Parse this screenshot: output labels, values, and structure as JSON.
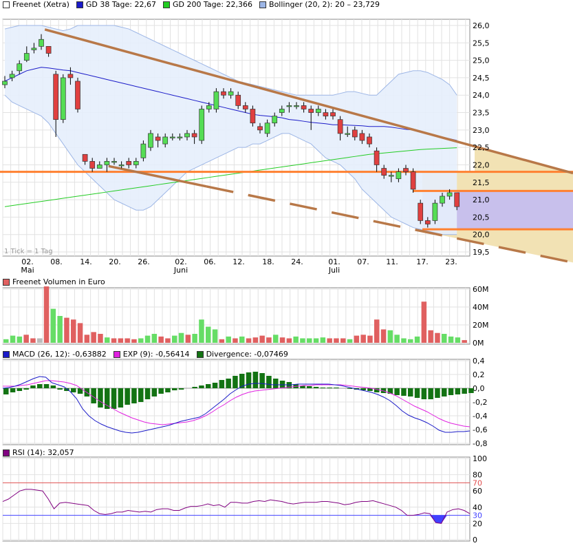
{
  "legends": {
    "price": [
      {
        "label": "Freenet (Xetra)",
        "color": "#ffffff"
      },
      {
        "label": "GD 38 Tage: 22,67",
        "color": "#1a1ac8"
      },
      {
        "label": "GD 200 Tage: 22,366",
        "color": "#22cc22"
      },
      {
        "label": "Bollinger (20, 2): 20 – 23,729",
        "color": "#9db6e6"
      }
    ],
    "volume": [
      {
        "label": "Freenet Volumen in Euro",
        "color": "#e06060"
      }
    ],
    "macd": [
      {
        "label": "MACD (26, 12): -0,63882",
        "color": "#1a1ac8"
      },
      {
        "label": "EXP (9): -0,56414",
        "color": "#e020e0"
      },
      {
        "label": "Divergence: -0,07469",
        "color": "#137313"
      }
    ],
    "rsi": [
      {
        "label": "RSI (14): 32,057",
        "color": "#800080"
      }
    ]
  },
  "tick_note": "1 Tick = 1 Tag",
  "colors": {
    "up": "#55dd55",
    "down": "#e04040",
    "trend": "#b87848",
    "level": "#ff8030",
    "fill_tan": "#f2e2b4",
    "fill_purple": "#c8c0ec",
    "bollinger_fill": "#e6eefc",
    "ma38": "#1a1ac8",
    "ma200": "#22cc22",
    "vol_up": "#66dd66",
    "vol_down": "#e06060",
    "macd_line": "#1a1ac8",
    "exp_line": "#e020e0",
    "divergence": "#137313",
    "rsi_line": "#800080"
  },
  "chart_data": [
    {
      "type": "candlestick",
      "title": "Freenet (Xetra)",
      "ylim": [
        19.5,
        26.0
      ],
      "y_ticks": [
        "26,0",
        "25,5",
        "25,0",
        "24,5",
        "24,0",
        "23,5",
        "23,0",
        "22,5",
        "22,0",
        "21,5",
        "21,0",
        "20,5",
        "20,0",
        "19,5"
      ],
      "x_tick_labels": [
        "02.",
        "08.",
        "14.",
        "20.",
        "26.",
        "02.",
        "06.",
        "12.",
        "18.",
        "24.",
        "01.",
        "07.",
        "11.",
        "17.",
        "23."
      ],
      "month_labels": [
        "Mai",
        "Juni",
        "Juli"
      ],
      "candles": [
        {
          "o": 24.3,
          "c": 24.4,
          "h": 24.55,
          "l": 24.2
        },
        {
          "o": 24.5,
          "c": 24.6,
          "h": 24.7,
          "l": 24.4
        },
        {
          "o": 24.7,
          "c": 24.9,
          "h": 25.0,
          "l": 24.6
        },
        {
          "o": 25.0,
          "c": 25.2,
          "h": 25.4,
          "l": 24.95
        },
        {
          "o": 25.3,
          "c": 25.35,
          "h": 25.5,
          "l": 25.2
        },
        {
          "o": 25.4,
          "c": 25.6,
          "h": 25.75,
          "l": 25.3
        },
        {
          "o": 25.4,
          "c": 25.2,
          "h": 25.4,
          "l": 25.1
        },
        {
          "o": 24.6,
          "c": 23.3,
          "h": 24.7,
          "l": 22.8
        },
        {
          "o": 23.3,
          "c": 24.5,
          "h": 24.6,
          "l": 23.2
        },
        {
          "o": 24.6,
          "c": 24.5,
          "h": 24.8,
          "l": 24.3
        },
        {
          "o": 24.4,
          "c": 23.6,
          "h": 24.5,
          "l": 23.5
        },
        {
          "o": 22.3,
          "c": 22.1,
          "h": 22.3,
          "l": 22.0
        },
        {
          "o": 22.1,
          "c": 21.9,
          "h": 22.2,
          "l": 21.8
        },
        {
          "o": 21.9,
          "c": 22.0,
          "h": 22.1,
          "l": 21.9
        },
        {
          "o": 22.0,
          "c": 22.1,
          "h": 22.2,
          "l": 21.8
        },
        {
          "o": 22.1,
          "c": 22.1,
          "h": 22.2,
          "l": 22.0
        },
        {
          "o": 22.0,
          "c": 22.0,
          "h": 22.1,
          "l": 21.9
        },
        {
          "o": 22.1,
          "c": 22.0,
          "h": 22.2,
          "l": 21.9
        },
        {
          "o": 22.0,
          "c": 22.1,
          "h": 22.2,
          "l": 21.9
        },
        {
          "o": 22.2,
          "c": 22.6,
          "h": 22.7,
          "l": 22.1
        },
        {
          "o": 22.5,
          "c": 22.9,
          "h": 23.0,
          "l": 22.4
        },
        {
          "o": 22.8,
          "c": 22.7,
          "h": 22.9,
          "l": 22.5
        },
        {
          "o": 22.6,
          "c": 22.8,
          "h": 22.9,
          "l": 22.5
        },
        {
          "o": 22.8,
          "c": 22.8,
          "h": 22.9,
          "l": 22.7
        },
        {
          "o": 22.8,
          "c": 22.8,
          "h": 22.9,
          "l": 22.7
        },
        {
          "o": 22.8,
          "c": 22.9,
          "h": 23.0,
          "l": 22.7
        },
        {
          "o": 22.9,
          "c": 22.8,
          "h": 23.0,
          "l": 22.6
        },
        {
          "o": 22.7,
          "c": 23.6,
          "h": 23.7,
          "l": 22.6
        },
        {
          "o": 23.6,
          "c": 23.7,
          "h": 23.8,
          "l": 23.5
        },
        {
          "o": 23.6,
          "c": 24.1,
          "h": 24.2,
          "l": 23.5
        },
        {
          "o": 24.1,
          "c": 24.0,
          "h": 24.2,
          "l": 23.9
        },
        {
          "o": 24.0,
          "c": 24.1,
          "h": 24.2,
          "l": 23.9
        },
        {
          "o": 24.0,
          "c": 23.7,
          "h": 24.1,
          "l": 23.6
        },
        {
          "o": 23.7,
          "c": 23.6,
          "h": 23.8,
          "l": 23.5
        },
        {
          "o": 23.6,
          "c": 23.2,
          "h": 23.7,
          "l": 23.1
        },
        {
          "o": 23.1,
          "c": 23.0,
          "h": 23.2,
          "l": 22.9
        },
        {
          "o": 22.9,
          "c": 23.2,
          "h": 23.3,
          "l": 22.8
        },
        {
          "o": 23.2,
          "c": 23.4,
          "h": 23.5,
          "l": 23.1
        },
        {
          "o": 23.5,
          "c": 23.6,
          "h": 23.7,
          "l": 23.4
        },
        {
          "o": 23.7,
          "c": 23.7,
          "h": 23.8,
          "l": 23.5
        },
        {
          "o": 23.7,
          "c": 23.7,
          "h": 23.8,
          "l": 23.6
        },
        {
          "o": 23.7,
          "c": 23.6,
          "h": 23.8,
          "l": 23.5
        },
        {
          "o": 23.6,
          "c": 23.5,
          "h": 23.7,
          "l": 23.0
        },
        {
          "o": 23.5,
          "c": 23.6,
          "h": 23.7,
          "l": 23.4
        },
        {
          "o": 23.5,
          "c": 23.4,
          "h": 23.6,
          "l": 23.3
        },
        {
          "o": 23.5,
          "c": 23.4,
          "h": 23.6,
          "l": 23.3
        },
        {
          "o": 23.3,
          "c": 22.9,
          "h": 23.4,
          "l": 22.7
        },
        {
          "o": 22.9,
          "c": 22.9,
          "h": 23.1,
          "l": 22.8
        },
        {
          "o": 23.0,
          "c": 22.8,
          "h": 23.1,
          "l": 22.7
        },
        {
          "o": 22.9,
          "c": 22.7,
          "h": 23.0,
          "l": 22.6
        },
        {
          "o": 22.8,
          "c": 22.6,
          "h": 22.9,
          "l": 22.5
        },
        {
          "o": 22.4,
          "c": 22.0,
          "h": 22.5,
          "l": 21.8
        },
        {
          "o": 21.9,
          "c": 21.7,
          "h": 22.0,
          "l": 21.6
        },
        {
          "o": 21.7,
          "c": 21.7,
          "h": 21.8,
          "l": 21.5
        },
        {
          "o": 21.6,
          "c": 21.8,
          "h": 21.9,
          "l": 21.5
        },
        {
          "o": 21.9,
          "c": 21.8,
          "h": 22.0,
          "l": 21.7
        },
        {
          "o": 21.8,
          "c": 21.3,
          "h": 21.9,
          "l": 21.2
        },
        {
          "o": 20.9,
          "c": 20.4,
          "h": 21.0,
          "l": 20.3
        },
        {
          "o": 20.4,
          "c": 20.3,
          "h": 20.5,
          "l": 20.2
        },
        {
          "o": 20.4,
          "c": 20.9,
          "h": 21.0,
          "l": 20.3
        },
        {
          "o": 20.9,
          "c": 21.1,
          "h": 21.2,
          "l": 20.8
        },
        {
          "o": 21.1,
          "c": 21.2,
          "h": 21.3,
          "l": 21.0
        },
        {
          "o": 21.2,
          "c": 20.8,
          "h": 21.2,
          "l": 20.7
        }
      ],
      "ma38": [
        24.4,
        24.5,
        24.6,
        24.7,
        24.75,
        24.8,
        24.78,
        24.75,
        24.72,
        24.7,
        24.65,
        24.6,
        24.55,
        24.5,
        24.45,
        24.4,
        24.35,
        24.3,
        24.25,
        24.2,
        24.15,
        24.1,
        24.05,
        24.0,
        23.95,
        23.9,
        23.85,
        23.8,
        23.75,
        23.7,
        23.65,
        23.6,
        23.55,
        23.5,
        23.45,
        23.42,
        23.4,
        23.38,
        23.35,
        23.3,
        23.28,
        23.25,
        23.22,
        23.2,
        23.18,
        23.15,
        23.15,
        23.14,
        23.13,
        23.12,
        23.1,
        23.1,
        23.1,
        23.08,
        23.05,
        23.02,
        23.0,
        22.95,
        22.9,
        22.85,
        22.8,
        22.75,
        22.7
      ],
      "ma200": [
        20.8,
        20.83,
        20.86,
        20.89,
        20.92,
        20.95,
        20.98,
        21.01,
        21.04,
        21.07,
        21.1,
        21.13,
        21.16,
        21.19,
        21.22,
        21.25,
        21.28,
        21.31,
        21.34,
        21.37,
        21.4,
        21.43,
        21.46,
        21.49,
        21.52,
        21.55,
        21.58,
        21.61,
        21.64,
        21.67,
        21.7,
        21.73,
        21.76,
        21.79,
        21.82,
        21.85,
        21.88,
        21.91,
        21.94,
        21.97,
        22.0,
        22.03,
        22.06,
        22.09,
        22.12,
        22.15,
        22.18,
        22.21,
        22.24,
        22.27,
        22.3,
        22.32,
        22.34,
        22.36,
        22.38,
        22.4,
        22.42,
        22.44,
        22.45,
        22.46,
        22.47,
        22.48,
        22.49
      ],
      "boll_upper": [
        25.9,
        25.95,
        26.0,
        26.0,
        26.0,
        26.0,
        25.95,
        25.9,
        25.85,
        25.9,
        26.0,
        26.0,
        26.0,
        26.0,
        26.0,
        26.0,
        25.95,
        25.9,
        25.8,
        25.7,
        25.6,
        25.5,
        25.4,
        25.3,
        25.2,
        25.1,
        25.0,
        24.9,
        24.8,
        24.7,
        24.6,
        24.5,
        24.4,
        24.35,
        24.3,
        24.25,
        24.2,
        24.15,
        24.1,
        24.05,
        24.0,
        24.0,
        24.0,
        24.0,
        24.0,
        24.0,
        24.05,
        24.1,
        24.1,
        24.05,
        24.0,
        24.0,
        24.2,
        24.4,
        24.6,
        24.65,
        24.7,
        24.7,
        24.65,
        24.55,
        24.45,
        24.3,
        24.0
      ],
      "boll_lower": [
        24.0,
        23.8,
        23.7,
        23.6,
        23.5,
        23.4,
        23.2,
        22.9,
        22.6,
        22.3,
        22.0,
        21.8,
        21.6,
        21.4,
        21.2,
        21.0,
        20.9,
        20.8,
        20.7,
        20.7,
        20.8,
        21.0,
        21.2,
        21.4,
        21.6,
        21.8,
        21.9,
        22.0,
        22.1,
        22.2,
        22.3,
        22.4,
        22.5,
        22.5,
        22.6,
        22.6,
        22.7,
        22.8,
        22.9,
        22.9,
        22.8,
        22.7,
        22.6,
        22.4,
        22.2,
        22.1,
        22.0,
        21.8,
        21.6,
        21.3,
        21.1,
        20.9,
        20.7,
        20.5,
        20.4,
        20.3,
        20.2,
        20.15,
        20.1,
        20.05,
        20.0,
        20.0,
        20.0
      ],
      "levels": [
        21.8,
        21.25,
        20.15
      ],
      "trend_upper": {
        "start": {
          "i": 7,
          "y": 25.8
        },
        "end": {
          "i": 79,
          "y": 21.7
        }
      },
      "trend_lower": {
        "start": {
          "i": 18,
          "y": 21.8
        },
        "end": {
          "i": 79,
          "y": 19.15
        }
      }
    },
    {
      "type": "bar",
      "title": "Freenet Volumen in Euro",
      "ylim": [
        0,
        60
      ],
      "y_ticks": [
        "60M",
        "40M",
        "20M",
        "0M"
      ],
      "values": [
        4,
        8,
        7,
        9,
        5,
        5,
        63,
        38,
        30,
        28,
        26,
        22,
        9,
        12,
        10,
        6,
        5,
        5,
        5,
        4,
        5,
        8,
        10,
        7,
        5,
        8,
        11,
        9,
        10,
        26,
        18,
        15,
        4,
        7,
        5,
        7,
        5,
        6,
        8,
        6,
        9,
        6,
        5,
        7,
        5,
        5,
        5,
        6,
        5,
        5,
        5,
        4,
        8,
        9,
        8,
        26,
        15,
        14,
        9,
        5,
        4,
        7,
        46,
        14,
        11,
        10,
        7,
        6,
        3
      ],
      "up": [
        1,
        1,
        1,
        0,
        0,
        0,
        0,
        1,
        1,
        0,
        0,
        0,
        0,
        0,
        0,
        1,
        0,
        0,
        0,
        0,
        1,
        1,
        1,
        0,
        0,
        1,
        1,
        0,
        1,
        1,
        1,
        1,
        0,
        1,
        0,
        1,
        0,
        0,
        0,
        0,
        1,
        0,
        0,
        1,
        1,
        1,
        1,
        1,
        0,
        0,
        0,
        1,
        0,
        0,
        0,
        0,
        0,
        1,
        1,
        1,
        1,
        1,
        0,
        0,
        0,
        1,
        1,
        1,
        0
      ]
    },
    {
      "type": "line+bar",
      "title": "MACD (26, 12)",
      "ylim": [
        -0.8,
        0.4
      ],
      "y_ticks": [
        "0,4",
        "0,2",
        "0,0",
        "-0,2",
        "-0,4",
        "-0,6",
        "-0,8"
      ],
      "macd": [
        0.0,
        0.01,
        0.03,
        0.06,
        0.1,
        0.14,
        0.17,
        0.16,
        0.08,
        0.05,
        0.02,
        -0.05,
        -0.15,
        -0.3,
        -0.4,
        -0.47,
        -0.52,
        -0.56,
        -0.59,
        -0.62,
        -0.64,
        -0.65,
        -0.64,
        -0.62,
        -0.6,
        -0.58,
        -0.56,
        -0.54,
        -0.51,
        -0.48,
        -0.46,
        -0.44,
        -0.42,
        -0.37,
        -0.3,
        -0.23,
        -0.16,
        -0.08,
        -0.02,
        0.03,
        0.06,
        0.07,
        0.07,
        0.06,
        0.05,
        0.05,
        0.05,
        0.05,
        0.06,
        0.06,
        0.06,
        0.06,
        0.06,
        0.06,
        0.05,
        0.04,
        0.02,
        0.0,
        -0.02,
        -0.04,
        -0.06,
        -0.09,
        -0.13,
        -0.18,
        -0.25,
        -0.33,
        -0.39,
        -0.43,
        -0.46,
        -0.5,
        -0.55,
        -0.61,
        -0.64,
        -0.64,
        -0.63,
        -0.63,
        -0.62
      ],
      "exp": [
        0.03,
        0.03,
        0.03,
        0.04,
        0.05,
        0.07,
        0.09,
        0.11,
        0.11,
        0.1,
        0.09,
        0.07,
        0.04,
        -0.02,
        -0.08,
        -0.14,
        -0.2,
        -0.25,
        -0.3,
        -0.35,
        -0.39,
        -0.43,
        -0.46,
        -0.49,
        -0.51,
        -0.52,
        -0.53,
        -0.52,
        -0.51,
        -0.5,
        -0.49,
        -0.47,
        -0.44,
        -0.4,
        -0.35,
        -0.29,
        -0.24,
        -0.18,
        -0.13,
        -0.09,
        -0.06,
        -0.04,
        -0.03,
        -0.02,
        -0.01,
        0.0,
        0.01,
        0.02,
        0.03,
        0.04,
        0.04,
        0.05,
        0.05,
        0.05,
        0.05,
        0.05,
        0.04,
        0.03,
        0.02,
        0.01,
        0.0,
        -0.02,
        -0.04,
        -0.07,
        -0.11,
        -0.16,
        -0.21,
        -0.26,
        -0.3,
        -0.34,
        -0.39,
        -0.44,
        -0.48,
        -0.51,
        -0.53,
        -0.55,
        -0.56
      ],
      "divergence": [
        -0.09,
        -0.06,
        -0.04,
        -0.02,
        0.04,
        0.06,
        0.06,
        0.04,
        -0.02,
        -0.04,
        -0.06,
        -0.08,
        -0.12,
        -0.22,
        -0.28,
        -0.3,
        -0.3,
        -0.28,
        -0.24,
        -0.22,
        -0.2,
        -0.16,
        -0.12,
        -0.08,
        -0.06,
        -0.03,
        -0.02,
        0.0,
        0.02,
        0.04,
        0.06,
        0.08,
        0.12,
        0.14,
        0.18,
        0.21,
        0.23,
        0.24,
        0.22,
        0.18,
        0.14,
        0.11,
        0.09,
        0.06,
        0.04,
        0.03,
        0.02,
        0.01,
        0.01,
        0.01,
        0.0,
        -0.01,
        -0.02,
        -0.03,
        -0.04,
        -0.06,
        -0.07,
        -0.08,
        -0.1,
        -0.11,
        -0.12,
        -0.14,
        -0.16,
        -0.16,
        -0.14,
        -0.12,
        -0.1,
        -0.09,
        -0.08,
        -0.07
      ]
    },
    {
      "type": "line",
      "title": "RSI (14)",
      "ylim": [
        0,
        100
      ],
      "y_ticks": [
        "100",
        "80",
        "70",
        "60",
        "40",
        "30",
        "20",
        "0"
      ],
      "levels": [
        70,
        30
      ],
      "values": [
        47,
        50,
        55,
        60,
        62,
        62,
        61,
        60,
        50,
        38,
        45,
        46,
        45,
        44,
        43,
        42,
        36,
        32,
        31,
        32,
        34,
        34,
        36,
        35,
        34,
        35,
        34,
        37,
        38,
        38,
        36,
        36,
        39,
        41,
        41,
        42,
        44,
        42,
        43,
        40,
        46,
        46,
        45,
        45,
        47,
        48,
        47,
        49,
        48,
        47,
        45,
        44,
        45,
        46,
        46,
        46,
        47,
        47,
        46,
        45,
        43,
        44,
        46,
        47,
        47,
        48,
        46,
        44,
        42,
        40,
        36,
        30,
        30,
        31,
        33,
        32,
        21,
        20,
        34,
        37,
        38,
        36,
        32
      ]
    }
  ]
}
